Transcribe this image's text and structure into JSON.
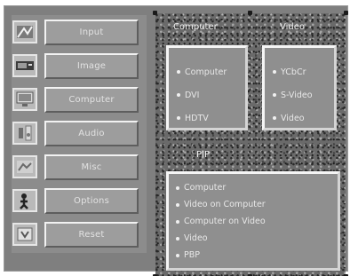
{
  "menu": {
    "items": [
      {
        "label": "Input",
        "icon": "input-icon"
      },
      {
        "label": "Image",
        "icon": "image-icon"
      },
      {
        "label": "Computer",
        "icon": "computer-icon"
      },
      {
        "label": "Audio",
        "icon": "audio-icon"
      },
      {
        "label": "Misc",
        "icon": "misc-icon"
      },
      {
        "label": "Options",
        "icon": "options-icon"
      },
      {
        "label": "Reset",
        "icon": "reset-icon"
      }
    ]
  },
  "panel": {
    "computer": {
      "heading": "Computer",
      "items": [
        "Computer",
        "DVI",
        "HDTV"
      ]
    },
    "video": {
      "heading": "Video",
      "items": [
        "YCbCr",
        "S-Video",
        "Video"
      ]
    },
    "pip": {
      "heading": "PIP",
      "items": [
        "Computer",
        "Video on Computer",
        "Computer on Video",
        "Video",
        "PBP"
      ]
    }
  },
  "colors": {
    "background": "#7f7f7f",
    "button": "#9d9d9d",
    "panel": "#6a6a6a",
    "box": "#8f8f8f",
    "text": "#e8e8e8"
  }
}
